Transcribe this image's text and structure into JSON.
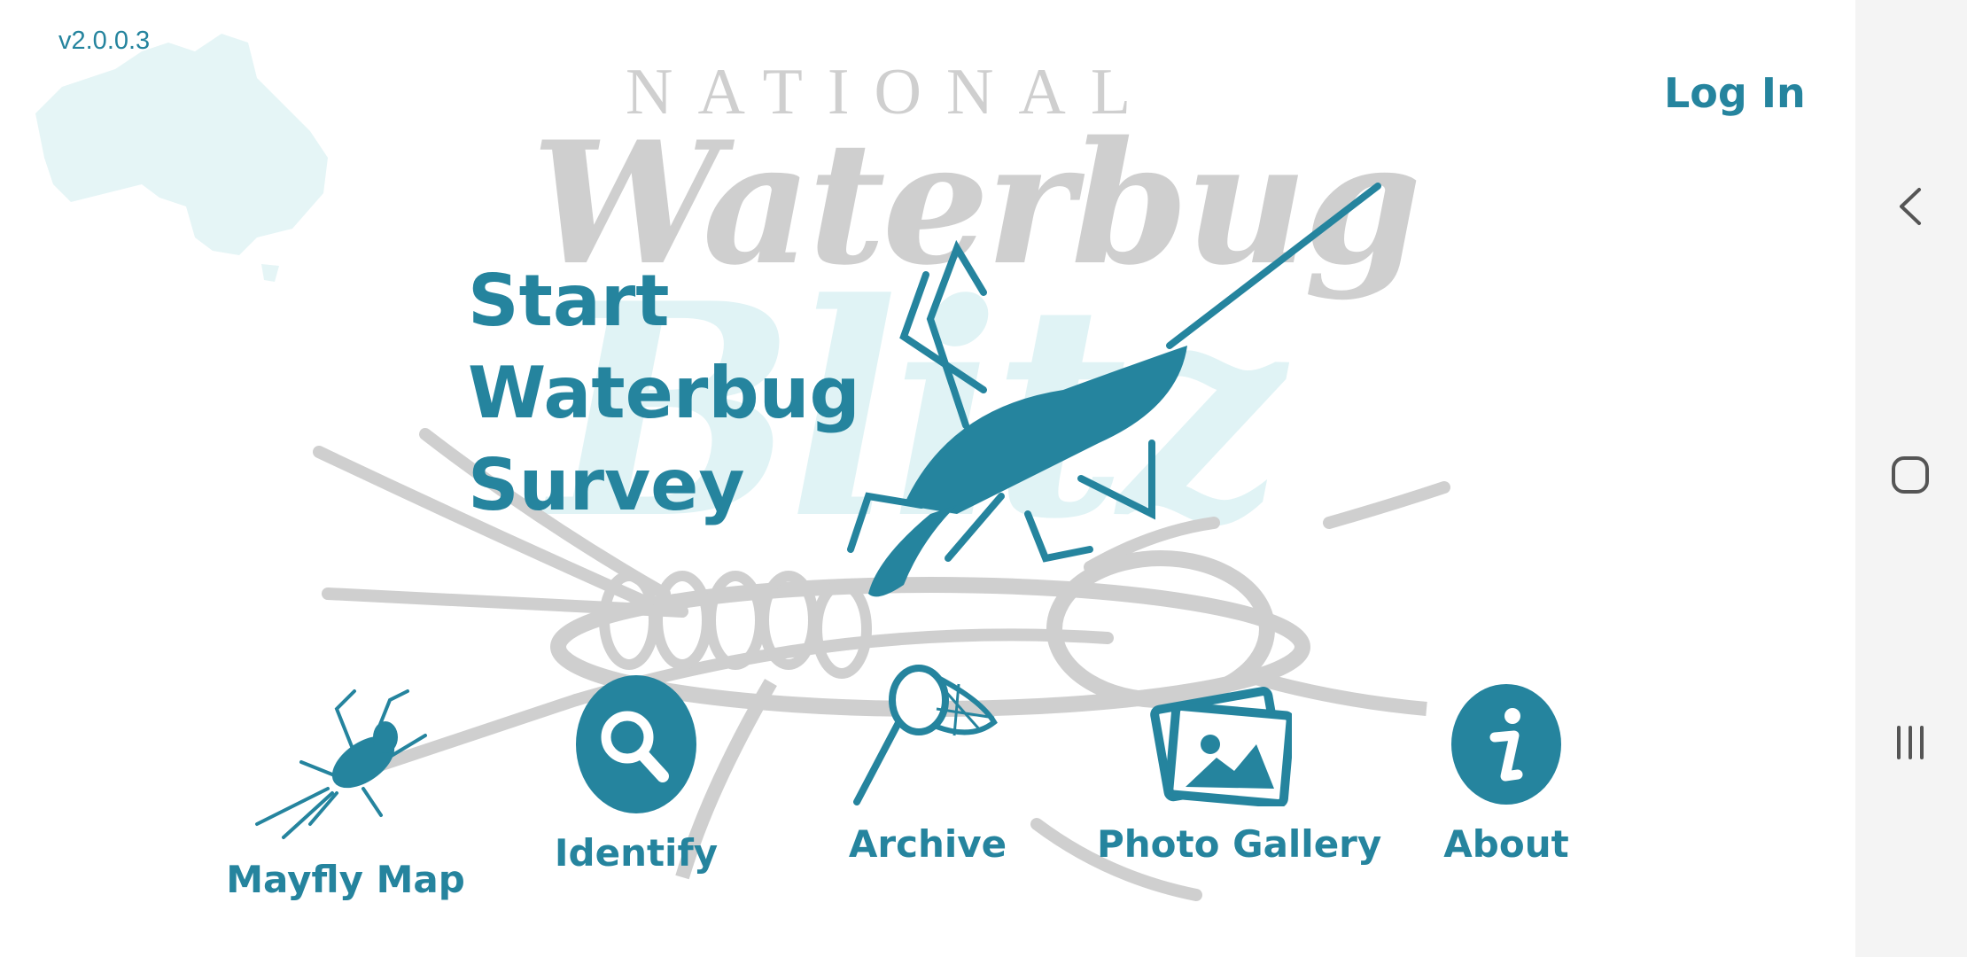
{
  "header": {
    "version": "v2.0.0.3",
    "login_label": "Log In"
  },
  "logo": {
    "line1": "NATIONAL",
    "line2": "Waterbug",
    "watermark": "Blitz"
  },
  "survey": {
    "line1": "Start",
    "line2": "Waterbug",
    "line3": "Survey"
  },
  "menu": [
    {
      "label": "Mayfly Map",
      "icon": "mayfly-icon"
    },
    {
      "label": "Identify",
      "icon": "search-icon"
    },
    {
      "label": "Archive",
      "icon": "net-icon"
    },
    {
      "label": "Photo Gallery",
      "icon": "photo-gallery-icon"
    },
    {
      "label": "About",
      "icon": "info-icon"
    }
  ],
  "colors": {
    "accent": "#25849e",
    "logo_gray": "#cfcfcf",
    "watermark": "#e0f3f5",
    "australia": "#e5f5f6"
  },
  "nav_icons": [
    "back-icon",
    "home-icon",
    "recents-icon"
  ]
}
